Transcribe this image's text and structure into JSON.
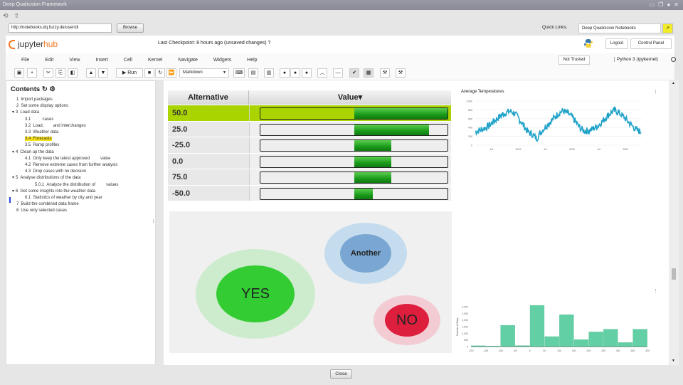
{
  "window": {
    "title": "Deep Qualicision Framework"
  },
  "addressbar": {
    "url": "http://notebooks.dq.fuzzy.de/user/di",
    "browse_label": "Browse",
    "quick_links_label": "Quick Links:",
    "quick_links_value": "Deep Qualicision Notebooks",
    "go_label": "⇗"
  },
  "jupyter": {
    "logo_text_1": "jupyter",
    "logo_text_2": "hub",
    "checkpoint": "Last Checkpoint: 8 hours ago  (unsaved changes) ?",
    "logout_label": "Logout",
    "control_panel_label": "Control Panel",
    "menu": [
      "File",
      "Edit",
      "View",
      "Insert",
      "Cell",
      "Kernel",
      "Navigate",
      "Widgets",
      "Help"
    ],
    "not_trusted": "Not Trusted",
    "kernel": "Python 3 (ipykernel)",
    "run_label": "▶ Run",
    "cell_type": "Markdown"
  },
  "toc": {
    "title": "Contents",
    "items": [
      {
        "num": "1",
        "label": "Import packages",
        "indent": 0
      },
      {
        "num": "2",
        "label": "Set some display options",
        "indent": 0
      },
      {
        "num": "3",
        "label": "Load data",
        "indent": 0,
        "toggle": "▾"
      },
      {
        "num": "3.1",
        "label": "        cases",
        "indent": 1
      },
      {
        "num": "3.2",
        "label": "Load,        and interchanges",
        "indent": 1
      },
      {
        "num": "3.3",
        "label": "Weather data",
        "indent": 1
      },
      {
        "num": "3.4",
        "label": "Forecasts",
        "indent": 1,
        "highlight": true
      },
      {
        "num": "3.5",
        "label": "Ramp profiles",
        "indent": 1
      },
      {
        "num": "4",
        "label": "Clean up the data",
        "indent": 0,
        "toggle": "▾"
      },
      {
        "num": "4.1",
        "label": "Only keep the latest approved         value",
        "indent": 1
      },
      {
        "num": "4.2",
        "label": "Remove extreme cases from further analysis",
        "indent": 1
      },
      {
        "num": "4.3",
        "label": "Drop cases with no decision",
        "indent": 1
      },
      {
        "num": "5",
        "label": "Analyse distributions of the data",
        "indent": 0,
        "toggle": "▾"
      },
      {
        "num": "5.0.1",
        "label": "Analyze the distribution of         values",
        "indent": 2
      },
      {
        "num": "6",
        "label": "Get some insights into the weather data",
        "indent": 0,
        "toggle": "▾"
      },
      {
        "num": "6.1",
        "label": "Statistics of weather by city and year",
        "indent": 1
      },
      {
        "num": "7",
        "label": "Build the combined data frame",
        "indent": 0
      },
      {
        "num": "8",
        "label": "Use only selected cases",
        "indent": 0
      }
    ]
  },
  "value_table": {
    "headers": [
      "Alternative",
      "Value▾"
    ],
    "rows": [
      {
        "alternative": "50.0",
        "value_fraction": 1.0,
        "selected": true
      },
      {
        "alternative": "25.0",
        "value_fraction": 0.8
      },
      {
        "alternative": "-25.0",
        "value_fraction": 0.4
      },
      {
        "alternative": "0.0",
        "value_fraction": 0.4
      },
      {
        "alternative": "75.0",
        "value_fraction": 0.4
      },
      {
        "alternative": "-50.0",
        "value_fraction": 0.2
      }
    ],
    "colors": {
      "selected": "#aad400",
      "bar": "#1a9a1a"
    }
  },
  "bubbles": [
    {
      "label": "YES",
      "inner": "#33cc33",
      "outer": "#cdeccd"
    },
    {
      "label": "Another",
      "inner": "#79a6d2",
      "outer": "#c4dced"
    },
    {
      "label": "NO",
      "inner": "#dd1f3d",
      "outer": "#f3ccd3"
    }
  ],
  "chart_data": [
    {
      "type": "line",
      "title": "Average Temperatures",
      "xlabel": "",
      "ylabel": "",
      "x_tick_labels": [
        "Jul",
        "2019",
        "Jul",
        "2020",
        "Jul",
        "2021"
      ],
      "y_tick_labels": [
        "0",
        "200",
        "400",
        "600",
        "800",
        "1,000"
      ],
      "ylim": [
        0,
        1000
      ],
      "grid": true,
      "color": "#1fa2c8",
      "series": [
        {
          "name": "Average Temperatures",
          "x_months_from_start": [
            0,
            1,
            2,
            3,
            4,
            5,
            6,
            7,
            8,
            9,
            10,
            11,
            12,
            13,
            14,
            15,
            16,
            17,
            18,
            19,
            20,
            21,
            22,
            23,
            24,
            25,
            26,
            27,
            28,
            29,
            30,
            31,
            32,
            33,
            34,
            35,
            36,
            37,
            38
          ],
          "values": [
            300,
            340,
            380,
            430,
            520,
            600,
            680,
            740,
            770,
            720,
            600,
            450,
            300,
            250,
            150,
            300,
            420,
            520,
            620,
            720,
            780,
            730,
            650,
            520,
            380,
            320,
            330,
            380,
            440,
            540,
            650,
            740,
            790,
            720,
            630,
            520,
            420,
            330,
            300
          ]
        }
      ]
    },
    {
      "type": "bar",
      "title": "",
      "xlabel": "",
      "ylabel": "Number of Days",
      "bin_edges": [
        -200,
        -150,
        -100,
        -50,
        0,
        50,
        100,
        150,
        200,
        250,
        300,
        350,
        400
      ],
      "x_tick_labels": [
        "-200",
        "-150",
        "-100",
        "-50",
        "0",
        "50",
        "100",
        "150",
        "200",
        "250",
        "300",
        "350",
        "400"
      ],
      "y_tick_labels": [
        "0",
        "500",
        "1,000",
        "1,500",
        "2,000",
        "2,500",
        "3,000"
      ],
      "ylim": [
        0,
        3000
      ],
      "color": "#62cfa4",
      "values": [
        60,
        10,
        1600,
        70,
        3100,
        750,
        2400,
        520,
        1100,
        1300,
        300,
        1300
      ]
    }
  ],
  "footer": {
    "close_label": "Close"
  }
}
